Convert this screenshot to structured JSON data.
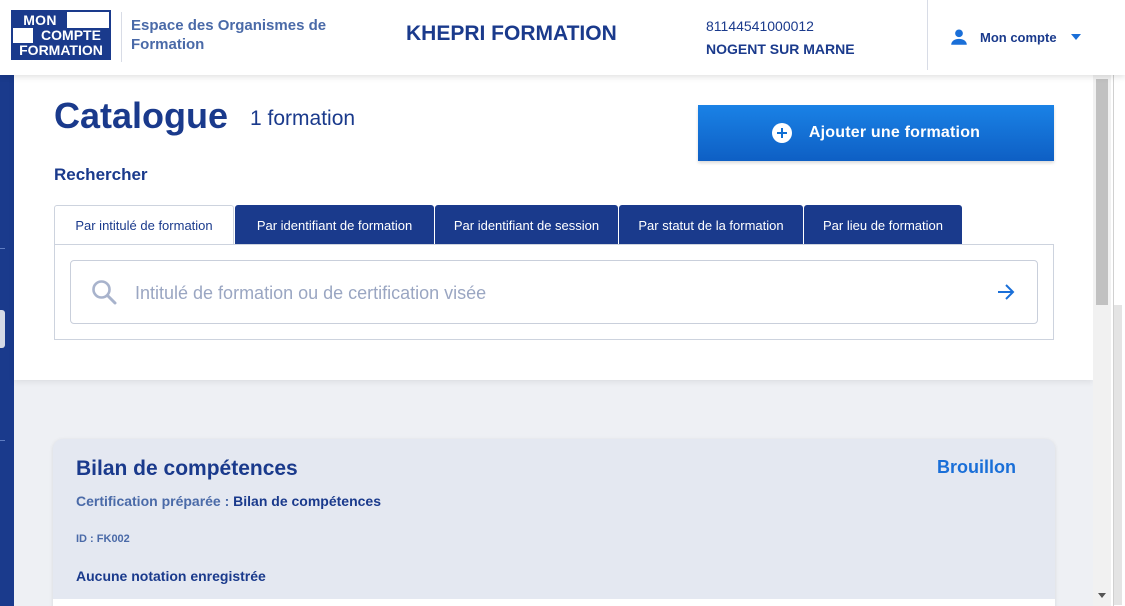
{
  "header": {
    "logo": {
      "line1": "MON",
      "line2": "COMPTE",
      "line3": "FORMATION"
    },
    "space_title": "Espace des Organismes de Formation",
    "organization": "KHEPRI FORMATION",
    "siret": "81144541000012",
    "city": "NOGENT SUR MARNE",
    "account_label": "Mon compte",
    "icons": {
      "account": "user-icon",
      "dropdown": "caret-down-icon"
    }
  },
  "catalogue": {
    "title": "Catalogue",
    "count": "1 formation",
    "add_button": "Ajouter une formation",
    "search_label": "Rechercher",
    "tabs": [
      {
        "label": "Par intitulé de formation",
        "active": true
      },
      {
        "label": "Par identifiant de formation",
        "active": false
      },
      {
        "label": "Par identifiant de session",
        "active": false
      },
      {
        "label": "Par statut de la formation",
        "active": false
      },
      {
        "label": "Par lieu de formation",
        "active": false
      }
    ],
    "search": {
      "placeholder": "Intitulé de formation ou de certification visée",
      "value": ""
    }
  },
  "results": [
    {
      "title": "Bilan de compétences",
      "status": "Brouillon",
      "certification_label": "Certification préparée :",
      "certification_value": "Bilan de compétences",
      "id": "ID : FK002",
      "rating": "Aucune notation enregistrée"
    }
  ],
  "colors": {
    "primary": "#1a3a8c",
    "accent": "#1a6fd8",
    "button": "#0e6ed3",
    "card_bg": "#e4e8f1"
  }
}
